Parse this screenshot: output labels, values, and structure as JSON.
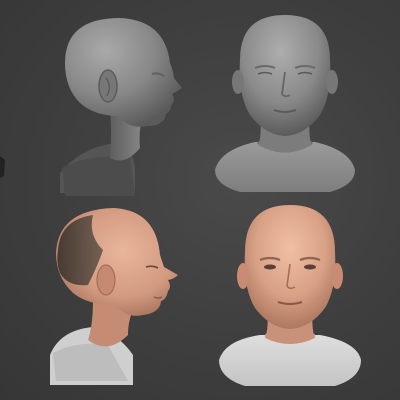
{
  "viewport": {
    "label": "head-scan-comparison",
    "background_color": "#3f3f3f"
  },
  "renders": [
    {
      "id": "sculpt-profile",
      "kind": "clay-sculpt",
      "view": "profile-right",
      "material_color": "#8c8c8c"
    },
    {
      "id": "sculpt-front",
      "kind": "clay-sculpt",
      "view": "front",
      "material_color": "#8d8d8d"
    },
    {
      "id": "textured-profile",
      "kind": "textured-scan",
      "view": "profile-right",
      "skin_color": "#d9a489",
      "shirt_color": "#cfcfcf"
    },
    {
      "id": "textured-front",
      "kind": "textured-scan",
      "view": "front",
      "skin_color": "#dca58b",
      "shirt_color": "#d2d2d2"
    }
  ]
}
